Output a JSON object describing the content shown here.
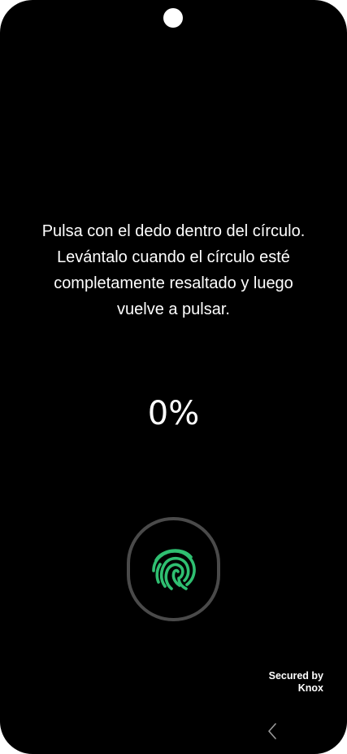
{
  "instructions": {
    "line1": "Pulsa con el dedo dentro del círculo.",
    "line2": "Levántalo cuando el círculo esté",
    "line3": "completamente resaltado y luego",
    "line4": "vuelve a pulsar."
  },
  "progress": {
    "label": "0%",
    "value": 0
  },
  "sensor": {
    "icon": "fingerprint-icon",
    "icon_color": "#2fbf71",
    "ring_color": "#4a4a4a"
  },
  "knox": {
    "line1": "Secured by",
    "line2": "Knox"
  },
  "navigation": {
    "back_icon": "chevron-left-icon"
  },
  "colors": {
    "background": "#000000",
    "text": "#ffffff",
    "accent": "#2fbf71"
  }
}
